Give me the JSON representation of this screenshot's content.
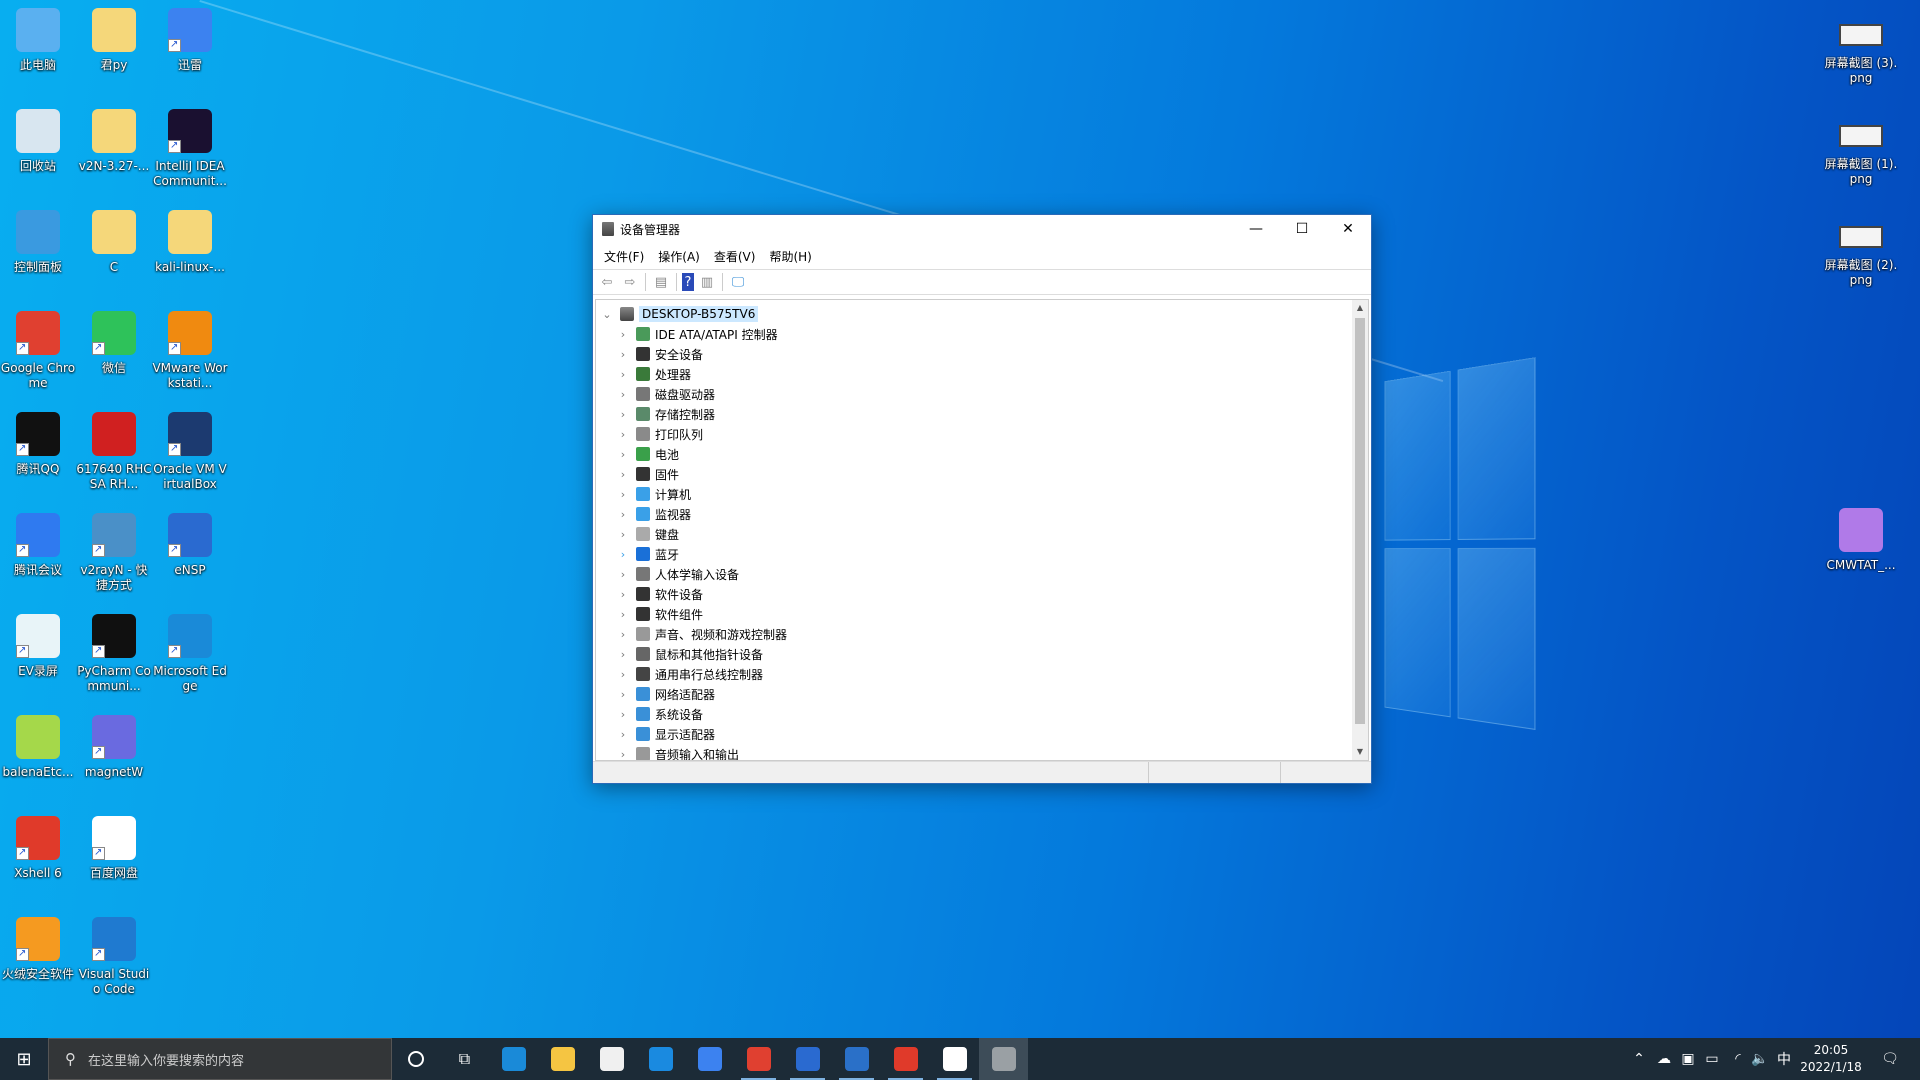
{
  "desktop": {
    "left_icons": [
      {
        "label": "此电脑",
        "color": "#5ab0f0",
        "shortcut": false
      },
      {
        "label": "君py",
        "color": "#f5d77a",
        "shortcut": false
      },
      {
        "label": "迅雷",
        "color": "#3c82f0",
        "shortcut": true
      },
      {
        "label": "回收站",
        "color": "#d8e6f0",
        "shortcut": false
      },
      {
        "label": "v2N-3.27-...",
        "color": "#f5d77a",
        "shortcut": false
      },
      {
        "label": "IntelliJ IDEA Communit...",
        "color": "#1a1030",
        "shortcut": true
      },
      {
        "label": "控制面板",
        "color": "#3a9ae0",
        "shortcut": false
      },
      {
        "label": "C",
        "color": "#f5d77a",
        "shortcut": false
      },
      {
        "label": "kali-linux-...",
        "color": "#f5d77a",
        "shortcut": false
      },
      {
        "label": "Google Chrome",
        "color": "#e04030",
        "shortcut": true
      },
      {
        "label": "微信",
        "color": "#2ec25a",
        "shortcut": true
      },
      {
        "label": "VMware Workstati...",
        "color": "#f08a10",
        "shortcut": true
      },
      {
        "label": "腾讯QQ",
        "color": "#111111",
        "shortcut": true
      },
      {
        "label": "617640 RHCSA RH...",
        "color": "#d02020",
        "shortcut": false
      },
      {
        "label": "Oracle VM VirtualBox",
        "color": "#1c3a70",
        "shortcut": true
      },
      {
        "label": "腾讯会议",
        "color": "#2f7af0",
        "shortcut": true
      },
      {
        "label": "v2rayN - 快捷方式",
        "color": "#4a90c8",
        "shortcut": true
      },
      {
        "label": "eNSP",
        "color": "#2a6ad0",
        "shortcut": true
      },
      {
        "label": "EV录屏",
        "color": "#e8f4f8",
        "shortcut": true
      },
      {
        "label": "PyCharm Communi...",
        "color": "#101010",
        "shortcut": true
      },
      {
        "label": "Microsoft Edge",
        "color": "#1a8ad8",
        "shortcut": true
      },
      {
        "label": "balenaEtc...",
        "color": "#a5d84a",
        "shortcut": false
      },
      {
        "label": "magnetW",
        "color": "#6a6ae0",
        "shortcut": true
      },
      {
        "label": "Xshell 6",
        "color": "#e03a2a",
        "shortcut": true
      },
      {
        "label": "百度网盘",
        "color": "#ffffff",
        "shortcut": true
      },
      {
        "label": "火绒安全软件",
        "color": "#f59a20",
        "shortcut": true
      },
      {
        "label": "Visual Studio Code",
        "color": "#1f7ad0",
        "shortcut": true
      }
    ],
    "right_icons": [
      {
        "label": "屏幕截图 (3).png",
        "color": "#f4f4f4",
        "shortcut": false
      },
      {
        "label": "屏幕截图 (1).png",
        "color": "#f4f4f4",
        "shortcut": false
      },
      {
        "label": "屏幕截图 (2).png",
        "color": "#f4f4f4",
        "shortcut": false
      },
      {
        "label": "CMWTAT_...",
        "color": "#b07ae8",
        "shortcut": false
      }
    ]
  },
  "window": {
    "title": "设备管理器",
    "controls": {
      "minimize": "—",
      "maximize": "☐",
      "close": "✕"
    },
    "menu": [
      "文件(F)",
      "操作(A)",
      "查看(V)",
      "帮助(H)"
    ],
    "toolbar": [
      {
        "name": "back-icon",
        "glyph": "⇦"
      },
      {
        "name": "forward-icon",
        "glyph": "⇨"
      },
      {
        "name": "properties-icon",
        "glyph": "▤"
      },
      {
        "name": "help-icon",
        "glyph": "?"
      },
      {
        "name": "show-hide-icon",
        "glyph": "▥"
      },
      {
        "name": "scan-hardware-icon",
        "glyph": "🖵"
      }
    ],
    "tree": {
      "root": "DESKTOP-B575TV6",
      "items": [
        {
          "label": "IDE ATA/ATAPI 控制器",
          "color": "#4a9a5a"
        },
        {
          "label": "安全设备",
          "color": "#333333"
        },
        {
          "label": "处理器",
          "color": "#3a7a3a"
        },
        {
          "label": "磁盘驱动器",
          "color": "#777777"
        },
        {
          "label": "存储控制器",
          "color": "#5a8a6a"
        },
        {
          "label": "打印队列",
          "color": "#8a8a8a"
        },
        {
          "label": "电池",
          "color": "#3aa04a"
        },
        {
          "label": "固件",
          "color": "#333333"
        },
        {
          "label": "计算机",
          "color": "#3aa0e8"
        },
        {
          "label": "监视器",
          "color": "#3aa0e8"
        },
        {
          "label": "键盘",
          "color": "#aaaaaa"
        },
        {
          "label": "蓝牙",
          "color": "#1a70d8"
        },
        {
          "label": "人体学输入设备",
          "color": "#777777"
        },
        {
          "label": "软件设备",
          "color": "#333333"
        },
        {
          "label": "软件组件",
          "color": "#333333"
        },
        {
          "label": "声音、视频和游戏控制器",
          "color": "#999999"
        },
        {
          "label": "鼠标和其他指针设备",
          "color": "#666666"
        },
        {
          "label": "通用串行总线控制器",
          "color": "#444444"
        },
        {
          "label": "网络适配器",
          "color": "#3a90d8"
        },
        {
          "label": "系统设备",
          "color": "#3a90d8"
        },
        {
          "label": "显示适配器",
          "color": "#3a90d8"
        },
        {
          "label": "音频输入和输出",
          "color": "#999999"
        }
      ]
    }
  },
  "taskbar": {
    "search_placeholder": "在这里输入你要搜索的内容",
    "apps": [
      {
        "name": "cortana",
        "color": "transparent",
        "state": ""
      },
      {
        "name": "task-view",
        "color": "transparent",
        "state": ""
      },
      {
        "name": "edge",
        "color": "#1a8ad8",
        "state": ""
      },
      {
        "name": "file-explorer",
        "color": "#f5c542",
        "state": ""
      },
      {
        "name": "microsoft-store",
        "color": "#f0f0f0",
        "state": ""
      },
      {
        "name": "mail",
        "color": "#1a8ae0",
        "state": ""
      },
      {
        "name": "xunlei",
        "color": "#3c82f0",
        "state": ""
      },
      {
        "name": "chrome",
        "color": "#e04030",
        "state": "run"
      },
      {
        "name": "ensp",
        "color": "#2a6ad0",
        "state": "run"
      },
      {
        "name": "photos",
        "color": "#2a70c8",
        "state": "run"
      },
      {
        "name": "xshell",
        "color": "#e03a2a",
        "state": "run"
      },
      {
        "name": "typora",
        "color": "#ffffff",
        "state": "run"
      },
      {
        "name": "device-manager",
        "color": "#9aa0a4",
        "state": "active"
      }
    ],
    "tray": {
      "ime": "中",
      "time": "20:05",
      "date": "2022/1/18"
    }
  }
}
